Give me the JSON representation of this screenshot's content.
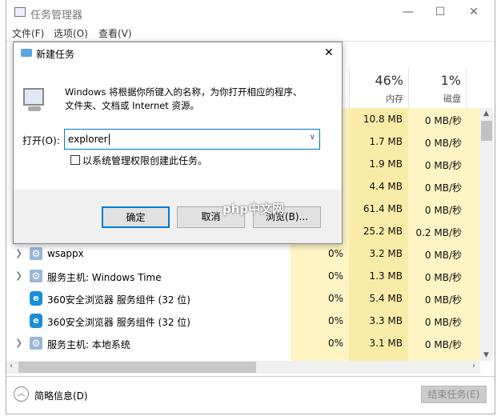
{
  "window": {
    "title": "任务管理器",
    "min": "—",
    "max": "☐",
    "close": "✕"
  },
  "menu": [
    "文件(F)",
    "选项(O)",
    "查看(V)"
  ],
  "headers": {
    "memory_pct": "46%",
    "memory_label": "内存",
    "disk_pct": "1%",
    "disk_label": "磁盘"
  },
  "rows": [
    {
      "name": "",
      "cpu": "",
      "mem": "10.8 MB",
      "disk": "0 MB/秒"
    },
    {
      "name": "",
      "cpu": "",
      "mem": "1.7 MB",
      "disk": "0 MB/秒"
    },
    {
      "name": "",
      "cpu": "",
      "mem": "1.9 MB",
      "disk": "0 MB/秒"
    },
    {
      "name": "",
      "cpu": "",
      "mem": "4.4 MB",
      "disk": "0 MB/秒"
    },
    {
      "name": "",
      "cpu": "",
      "mem": "61.4 MB",
      "disk": "0 MB/秒"
    },
    {
      "name": "",
      "cpu": "",
      "mem": "25.2 MB",
      "disk": "0.2 MB/秒"
    },
    {
      "name": "wsappx",
      "cpu": "0%",
      "mem": "3.2 MB",
      "disk": "0 MB/秒",
      "icon": "gear",
      "expand": true
    },
    {
      "name": "服务主机: Windows Time",
      "cpu": "0%",
      "mem": "1.3 MB",
      "disk": "0 MB/秒",
      "icon": "gear",
      "expand": true
    },
    {
      "name": "360安全浏览器 服务组件 (32 位)",
      "cpu": "0%",
      "mem": "5.4 MB",
      "disk": "0 MB/秒",
      "icon": "ie",
      "expand": false
    },
    {
      "name": "360安全浏览器 服务组件 (32 位)",
      "cpu": "0%",
      "mem": "3.3 MB",
      "disk": "0 MB/秒",
      "icon": "ie",
      "expand": false
    },
    {
      "name": "服务主机: 本地系统",
      "cpu": "0%",
      "mem": "3.1 MB",
      "disk": "0 MB/秒",
      "icon": "gear",
      "expand": true
    }
  ],
  "footer": {
    "less_details": "简略信息(D)",
    "end_task": "结束任务(E)"
  },
  "dialog": {
    "title": "新建任务",
    "close": "✕",
    "description_line1": "Windows 将根据你所键入的名称，为你打开相应的程序、",
    "description_line2": "文件夹、文档或 Internet 资源。",
    "open_label": "打开(O):",
    "open_value": "explorer",
    "admin_checkbox": "以系统管理权限创建此任务。",
    "ok": "确定",
    "cancel": "取消",
    "browse": "浏览(B)..."
  },
  "watermark": "php中文网",
  "colors": {
    "cpu_bg": "#fff4c4",
    "mem_bg": "#f9eca8",
    "accent": "#0078d7"
  }
}
